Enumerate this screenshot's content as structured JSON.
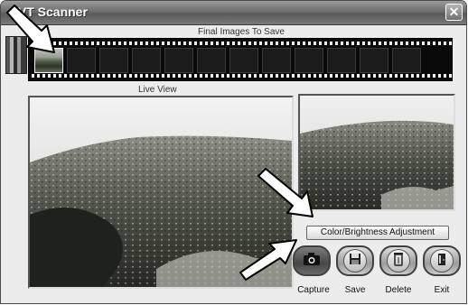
{
  "window": {
    "title": "OVT Scanner"
  },
  "filmstrip": {
    "label": "Final Images To Save",
    "cell_count": 12,
    "filled_cells": 1
  },
  "live_view": {
    "label": "Live  View"
  },
  "controls": {
    "adjust_label": "Color/Brightness Adjustment",
    "buttons": [
      {
        "id": "capture",
        "label": "Capture",
        "icon": "camera-icon"
      },
      {
        "id": "save",
        "label": "Save",
        "icon": "floppy-disk-icon"
      },
      {
        "id": "delete",
        "label": "Delete",
        "icon": "trash-icon"
      },
      {
        "id": "exit",
        "label": "Exit",
        "icon": "exit-icon"
      }
    ]
  },
  "colors": {
    "arrow_fill": "#ffffff",
    "arrow_stroke": "#000000"
  }
}
